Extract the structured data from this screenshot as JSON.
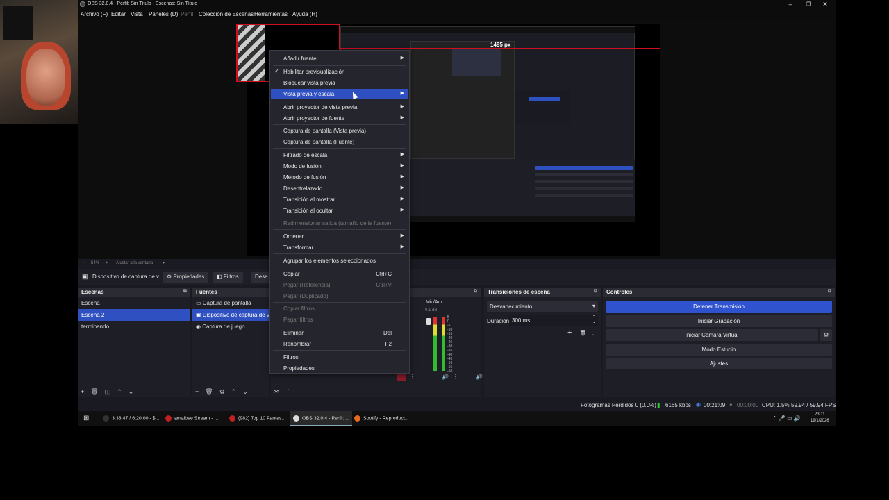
{
  "window": {
    "title": "OBS 32.0.4 - Perfil: Sin Título - Escenas: Sin Título"
  },
  "menu": [
    {
      "label": "Archivo (F)"
    },
    {
      "label": "Editar"
    },
    {
      "label": "Vista"
    },
    {
      "label": "Paneles (D)"
    },
    {
      "label": "Perfil"
    },
    {
      "label": "Colección de Escenas"
    },
    {
      "label": "Herramientas"
    },
    {
      "label": "Ayuda (H)"
    }
  ],
  "preview": {
    "measure": "1495 px",
    "zoom": "54%",
    "fit_label": "Ajustar a la ventana"
  },
  "source_toolbar": {
    "source_name": "Dispositivo de captura de v",
    "properties": "Propiedades",
    "filters": "Filtros",
    "deactivate": "Desa"
  },
  "scenes": {
    "title": "Escenas",
    "items": [
      "Escena",
      "Escena 2",
      "terminando"
    ],
    "selected": 1
  },
  "sources": {
    "title": "Fuentes",
    "items": [
      "Captura de pantalla",
      "Dispositivo de captura de v",
      "Captura de juego"
    ],
    "selected": 1
  },
  "mixer": {
    "channel_label": "Mic/Aux",
    "partial_label": "C",
    "db_label": "0.1 dB",
    "ticks": [
      "5",
      "0",
      "-5",
      "-10",
      "-15",
      "-20",
      "-25",
      "-30",
      "-35",
      "-40",
      "-45",
      "-50",
      "-55",
      "-60"
    ]
  },
  "transitions": {
    "title": "Transiciones de escena",
    "type": "Desvanecimiento",
    "duration_label": "Duración",
    "duration_value": "300 ms"
  },
  "controls": {
    "title": "Controles",
    "stop_stream": "Detener Transmisión",
    "start_recording": "Iniciar Grabación",
    "start_vcam": "Iniciar Cámara Virtual",
    "studio_mode": "Modo Estudio",
    "settings": "Ajustes"
  },
  "status": {
    "dropped": "Fotogramas Perdidos 0 (0.0%)",
    "bitrate": "6165 kbps",
    "stream_time": "00:21:09",
    "rec_time": "00:00:00",
    "cpu": "CPU: 1.5%",
    "fps": "59.94 / 59.94 FPS"
  },
  "taskbar": {
    "tasks": [
      "3:38:47 / 6:20:00 - $ ...",
      "amaibee Stream - ...",
      "(982) Top 10 Fantas...",
      "OBS 32.0.4 - Perfil: ...",
      "Spotify - Reproduct..."
    ],
    "time": "23:11",
    "date": "19/1/2026"
  },
  "context_menu": {
    "items": [
      {
        "label": "Añadir fuente",
        "submenu": true
      },
      {
        "label": "Habilitar previsualización",
        "checked": true
      },
      {
        "label": "Bloquear vista previa"
      },
      {
        "label": "Vista previa y escala",
        "submenu": true,
        "highlighted": true
      },
      {
        "label": "Abrir proyector de vista previa",
        "submenu": true
      },
      {
        "label": "Abrir proyector de fuente",
        "submenu": true
      },
      {
        "label": "Captura de pantalla (Vista previa)"
      },
      {
        "label": "Captura de pantalla (Fuente)"
      },
      {
        "label": "Filtrado de escala",
        "submenu": true
      },
      {
        "label": "Modo de fusión",
        "submenu": true
      },
      {
        "label": "Método de fusión",
        "submenu": true
      },
      {
        "label": "Desentrelazado",
        "submenu": true
      },
      {
        "label": "Transición al mostrar",
        "submenu": true
      },
      {
        "label": "Transición al ocultar",
        "submenu": true
      },
      {
        "label": "Redimensionar salida (tamaño de la fuente)",
        "disabled": true
      },
      {
        "label": "Ordenar",
        "submenu": true
      },
      {
        "label": "Transformar",
        "submenu": true
      },
      {
        "label": "Agrupar los elementos seleccionados"
      },
      {
        "label": "Copiar",
        "shortcut": "Ctrl+C"
      },
      {
        "label": "Pegar (Referencia)",
        "shortcut": "Ctrl+V",
        "disabled": true
      },
      {
        "label": "Pegar (Duplicado)",
        "disabled": true
      },
      {
        "label": "Copiar filtros",
        "disabled": true
      },
      {
        "label": "Pegar filtros",
        "disabled": true
      },
      {
        "label": "Eliminar",
        "shortcut": "Del"
      },
      {
        "label": "Renombrar",
        "shortcut": "F2"
      },
      {
        "label": "Filtros"
      },
      {
        "label": "Propiedades"
      }
    ]
  },
  "colors": {
    "accent": "#2e50c0",
    "bg": "#1a1b22",
    "panel_header": "#2a2b33",
    "red_guide": "#d01020"
  }
}
